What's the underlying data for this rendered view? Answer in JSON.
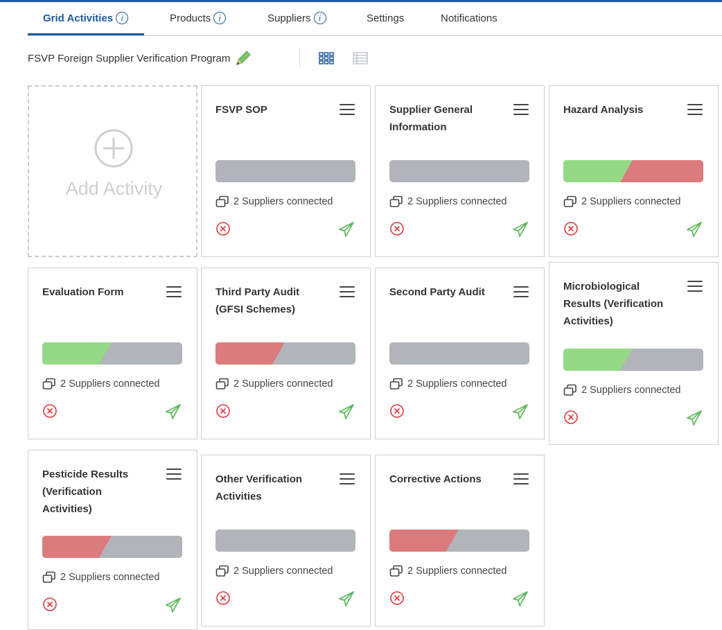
{
  "tabs": [
    {
      "label": "Grid Activities",
      "active": true,
      "info": true
    },
    {
      "label": "Products",
      "active": false,
      "info": true
    },
    {
      "label": "Suppliers",
      "active": false,
      "info": true
    },
    {
      "label": "Settings",
      "active": false,
      "info": false
    },
    {
      "label": "Notifications",
      "active": false,
      "info": false
    }
  ],
  "info_glyph": "i",
  "program": {
    "title": "FSVP Foreign Supplier Verification Program"
  },
  "add_activity": {
    "label": "Add Activity"
  },
  "colors": {
    "accent": "#1e5aa0",
    "green": "#95d986",
    "red": "#dc7b7e",
    "gray": "#b1b4b8",
    "icon_red": "#e0393e",
    "icon_green": "#5cb85c"
  },
  "icons": {
    "edit": "pencil-icon",
    "grid_view": "grid-view-icon",
    "list_view": "list-view-icon",
    "menu": "hamburger-menu-icon",
    "suppliers": "copy-icon",
    "status": "circle-x-icon",
    "send": "paper-plane-icon",
    "add": "circle-plus-icon"
  },
  "cards": [
    {
      "title": "FSVP SOP",
      "progress": {
        "green": 0,
        "red": 0
      },
      "suppliers_text": "2 Suppliers connected"
    },
    {
      "title": "Supplier General Information",
      "progress": {
        "green": 0,
        "red": 0
      },
      "suppliers_text": "2 Suppliers connected"
    },
    {
      "title": "Hazard Analysis",
      "progress": {
        "green": 0.45,
        "red": 0.55
      },
      "suppliers_text": "2 Suppliers connected"
    },
    {
      "title": "Evaluation Form",
      "progress": {
        "green": 0.45,
        "red": 0
      },
      "suppliers_text": "2 Suppliers connected"
    },
    {
      "title": "Third Party Audit (GFSI Schemes)",
      "progress": {
        "green": 0,
        "red": 0.45
      },
      "suppliers_text": "2 Suppliers connected"
    },
    {
      "title": "Second Party Audit",
      "progress": {
        "green": 0,
        "red": 0
      },
      "suppliers_text": "2 Suppliers connected"
    },
    {
      "title": "Microbiological Results (Verification Activities)",
      "progress": {
        "green": 0.45,
        "red": 0
      },
      "suppliers_text": "2 Suppliers connected"
    },
    {
      "title": "Pesticide Results (Verification Activities)",
      "progress": {
        "green": 0,
        "red": 0.45
      },
      "suppliers_text": "2 Suppliers connected"
    },
    {
      "title": "Other Verification Activities",
      "progress": {
        "green": 0,
        "red": 0
      },
      "suppliers_text": "2 Suppliers connected"
    },
    {
      "title": "Corrective Actions",
      "progress": {
        "green": 0,
        "red": 0.45
      },
      "suppliers_text": "2 Suppliers connected"
    }
  ]
}
